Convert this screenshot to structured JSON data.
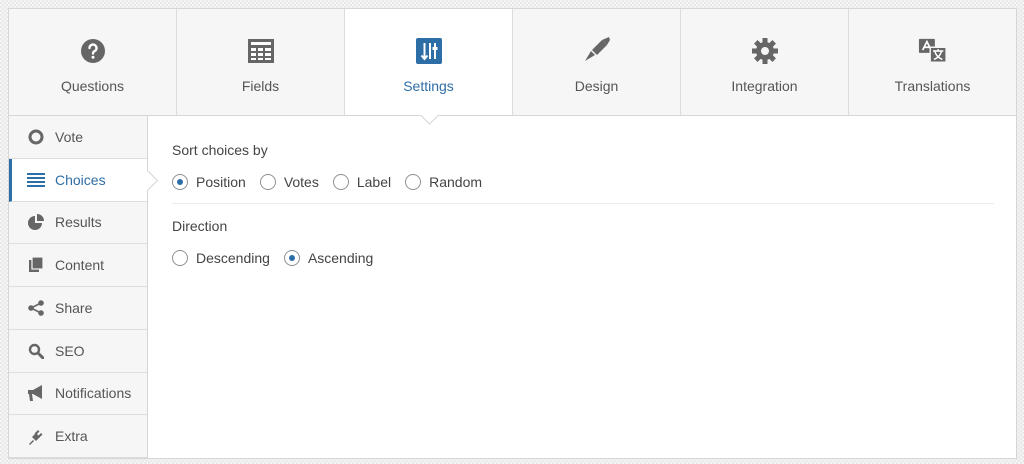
{
  "tabs": [
    {
      "label": "Questions",
      "icon": "question-circle-icon"
    },
    {
      "label": "Fields",
      "icon": "fields-table-icon"
    },
    {
      "label": "Settings",
      "icon": "sliders-icon",
      "active": true
    },
    {
      "label": "Design",
      "icon": "paintbrush-icon"
    },
    {
      "label": "Integration",
      "icon": "gear-icon"
    },
    {
      "label": "Translations",
      "icon": "translate-icon"
    }
  ],
  "sidebar": {
    "items": [
      {
        "label": "Vote",
        "icon": "circle-icon"
      },
      {
        "label": "Choices",
        "icon": "list-icon",
        "active": true
      },
      {
        "label": "Results",
        "icon": "pie-chart-icon"
      },
      {
        "label": "Content",
        "icon": "copy-icon"
      },
      {
        "label": "Share",
        "icon": "share-icon"
      },
      {
        "label": "SEO",
        "icon": "search-icon"
      },
      {
        "label": "Notifications",
        "icon": "megaphone-icon"
      },
      {
        "label": "Extra",
        "icon": "plugin-icon"
      }
    ]
  },
  "content": {
    "sort": {
      "title": "Sort choices by",
      "options": [
        "Position",
        "Votes",
        "Label",
        "Random"
      ],
      "selected": "Position"
    },
    "direction": {
      "title": "Direction",
      "options": [
        "Descending",
        "Ascending"
      ],
      "selected": "Ascending"
    }
  },
  "colors": {
    "accent": "#2e6ea6",
    "icon": "#666666",
    "border": "#d6d6d6"
  }
}
